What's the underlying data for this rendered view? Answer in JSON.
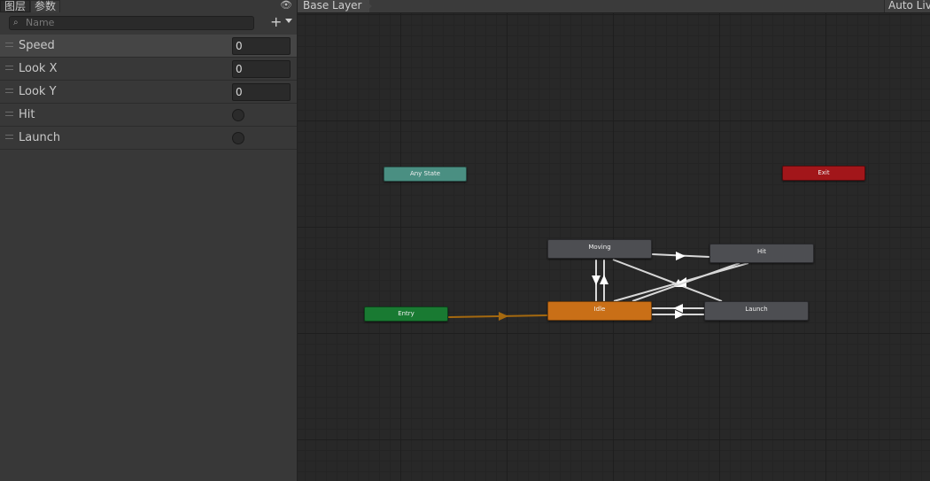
{
  "tabs": {
    "layers": "图层",
    "parameters": "参数"
  },
  "search": {
    "placeholder": "Name"
  },
  "parameters": [
    {
      "name": "Speed",
      "type": "float",
      "value": "0"
    },
    {
      "name": "Look X",
      "type": "float",
      "value": "0"
    },
    {
      "name": "Look Y",
      "type": "float",
      "value": "0"
    },
    {
      "name": "Hit",
      "type": "trigger"
    },
    {
      "name": "Launch",
      "type": "trigger"
    }
  ],
  "breadcrumb": {
    "layer": "Base Layer"
  },
  "toolbar": {
    "auto_live": "Auto Live"
  },
  "states": {
    "any_state": "Any State",
    "exit": "Exit",
    "entry": "Entry",
    "idle": "Idle",
    "moving": "Moving",
    "hit": "Hit",
    "launch": "Launch"
  },
  "colors": {
    "any_state": "#4a8f82",
    "exit": "#a2161a",
    "entry": "#197a32",
    "default_state": "#c96f17",
    "state": "#4d4e52",
    "default_transition": "#a5690f",
    "transition": "#d8d8d8"
  },
  "icons": {
    "visibility": "eye-icon",
    "search": "search-icon",
    "add": "plus-icon"
  }
}
